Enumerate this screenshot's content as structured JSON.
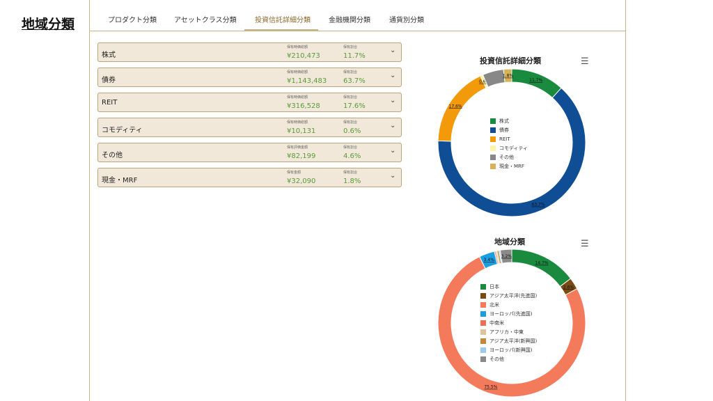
{
  "slide_title": "地域分類",
  "tabs": [
    {
      "label": "プロダクト分類"
    },
    {
      "label": "アセットクラス分類"
    },
    {
      "label": "投資信託詳細分類"
    },
    {
      "label": "金融機関分類"
    },
    {
      "label": "通貨別分類"
    }
  ],
  "active_tab": 2,
  "cards": [
    {
      "name": "株式",
      "amount_label": "保有時価総額",
      "amount": "¥210,473",
      "ratio_label": "保有割合",
      "ratio": "11.7%"
    },
    {
      "name": "債券",
      "amount_label": "保有時価総額",
      "amount": "¥1,143,483",
      "ratio_label": "保有割合",
      "ratio": "63.7%"
    },
    {
      "name": "REIT",
      "amount_label": "保有時価総額",
      "amount": "¥316,528",
      "ratio_label": "保有割合",
      "ratio": "17.6%"
    },
    {
      "name": "コモディティ",
      "amount_label": "保有時価総額",
      "amount": "¥10,131",
      "ratio_label": "保有割合",
      "ratio": "0.6%"
    },
    {
      "name": "その他",
      "amount_label": "保有評価金額",
      "amount": "¥82,199",
      "ratio_label": "保有割合",
      "ratio": "4.6%"
    },
    {
      "name": "現金・MRF",
      "amount_label": "保有金額",
      "amount": "¥32,090",
      "ratio_label": "保有割合",
      "ratio": "1.8%"
    }
  ],
  "icons": {
    "chevron": "chevron-down-icon",
    "menu": "hamburger-menu-icon"
  },
  "chart_data": [
    {
      "type": "pie",
      "title": "投資信託詳細分類",
      "donut": true,
      "categories": [
        "株式",
        "債券",
        "REIT",
        "コモディティ",
        "その他",
        "現金・MRF"
      ],
      "values": [
        11.7,
        63.7,
        17.6,
        0.6,
        4.6,
        1.8
      ],
      "labels": [
        "11.7%",
        "63.7%",
        "17.6%",
        "0.6%",
        "",
        "1.8%"
      ],
      "colors": [
        "#1a8a3e",
        "#0f4d94",
        "#f29a0a",
        "#fff3a8",
        "#888888",
        "#d8b25a"
      ],
      "legend": "center"
    },
    {
      "type": "pie",
      "title": "地域分類",
      "donut": true,
      "categories": [
        "日本",
        "アジア太平洋(先進国)",
        "北米",
        "ヨーロッパ(先進国)",
        "中南米",
        "アフリカ・中東",
        "アジア太平洋(新興国)",
        "ヨーロッパ(新興国)",
        "その他"
      ],
      "values": [
        14.7,
        2.6,
        75.5,
        3.4,
        0.3,
        0.3,
        0.4,
        0.3,
        2.5
      ],
      "labels": [
        "14.7%",
        "2.6%",
        "75.5%",
        "3.4%",
        "",
        "",
        "",
        "",
        "3.2%"
      ],
      "colors": [
        "#1a8a3e",
        "#7a4a12",
        "#f47a5c",
        "#1a9ee0",
        "#ea6f5a",
        "#dcc49a",
        "#c0883a",
        "#9ccbee",
        "#8a8a8a"
      ],
      "legend": "center"
    }
  ]
}
